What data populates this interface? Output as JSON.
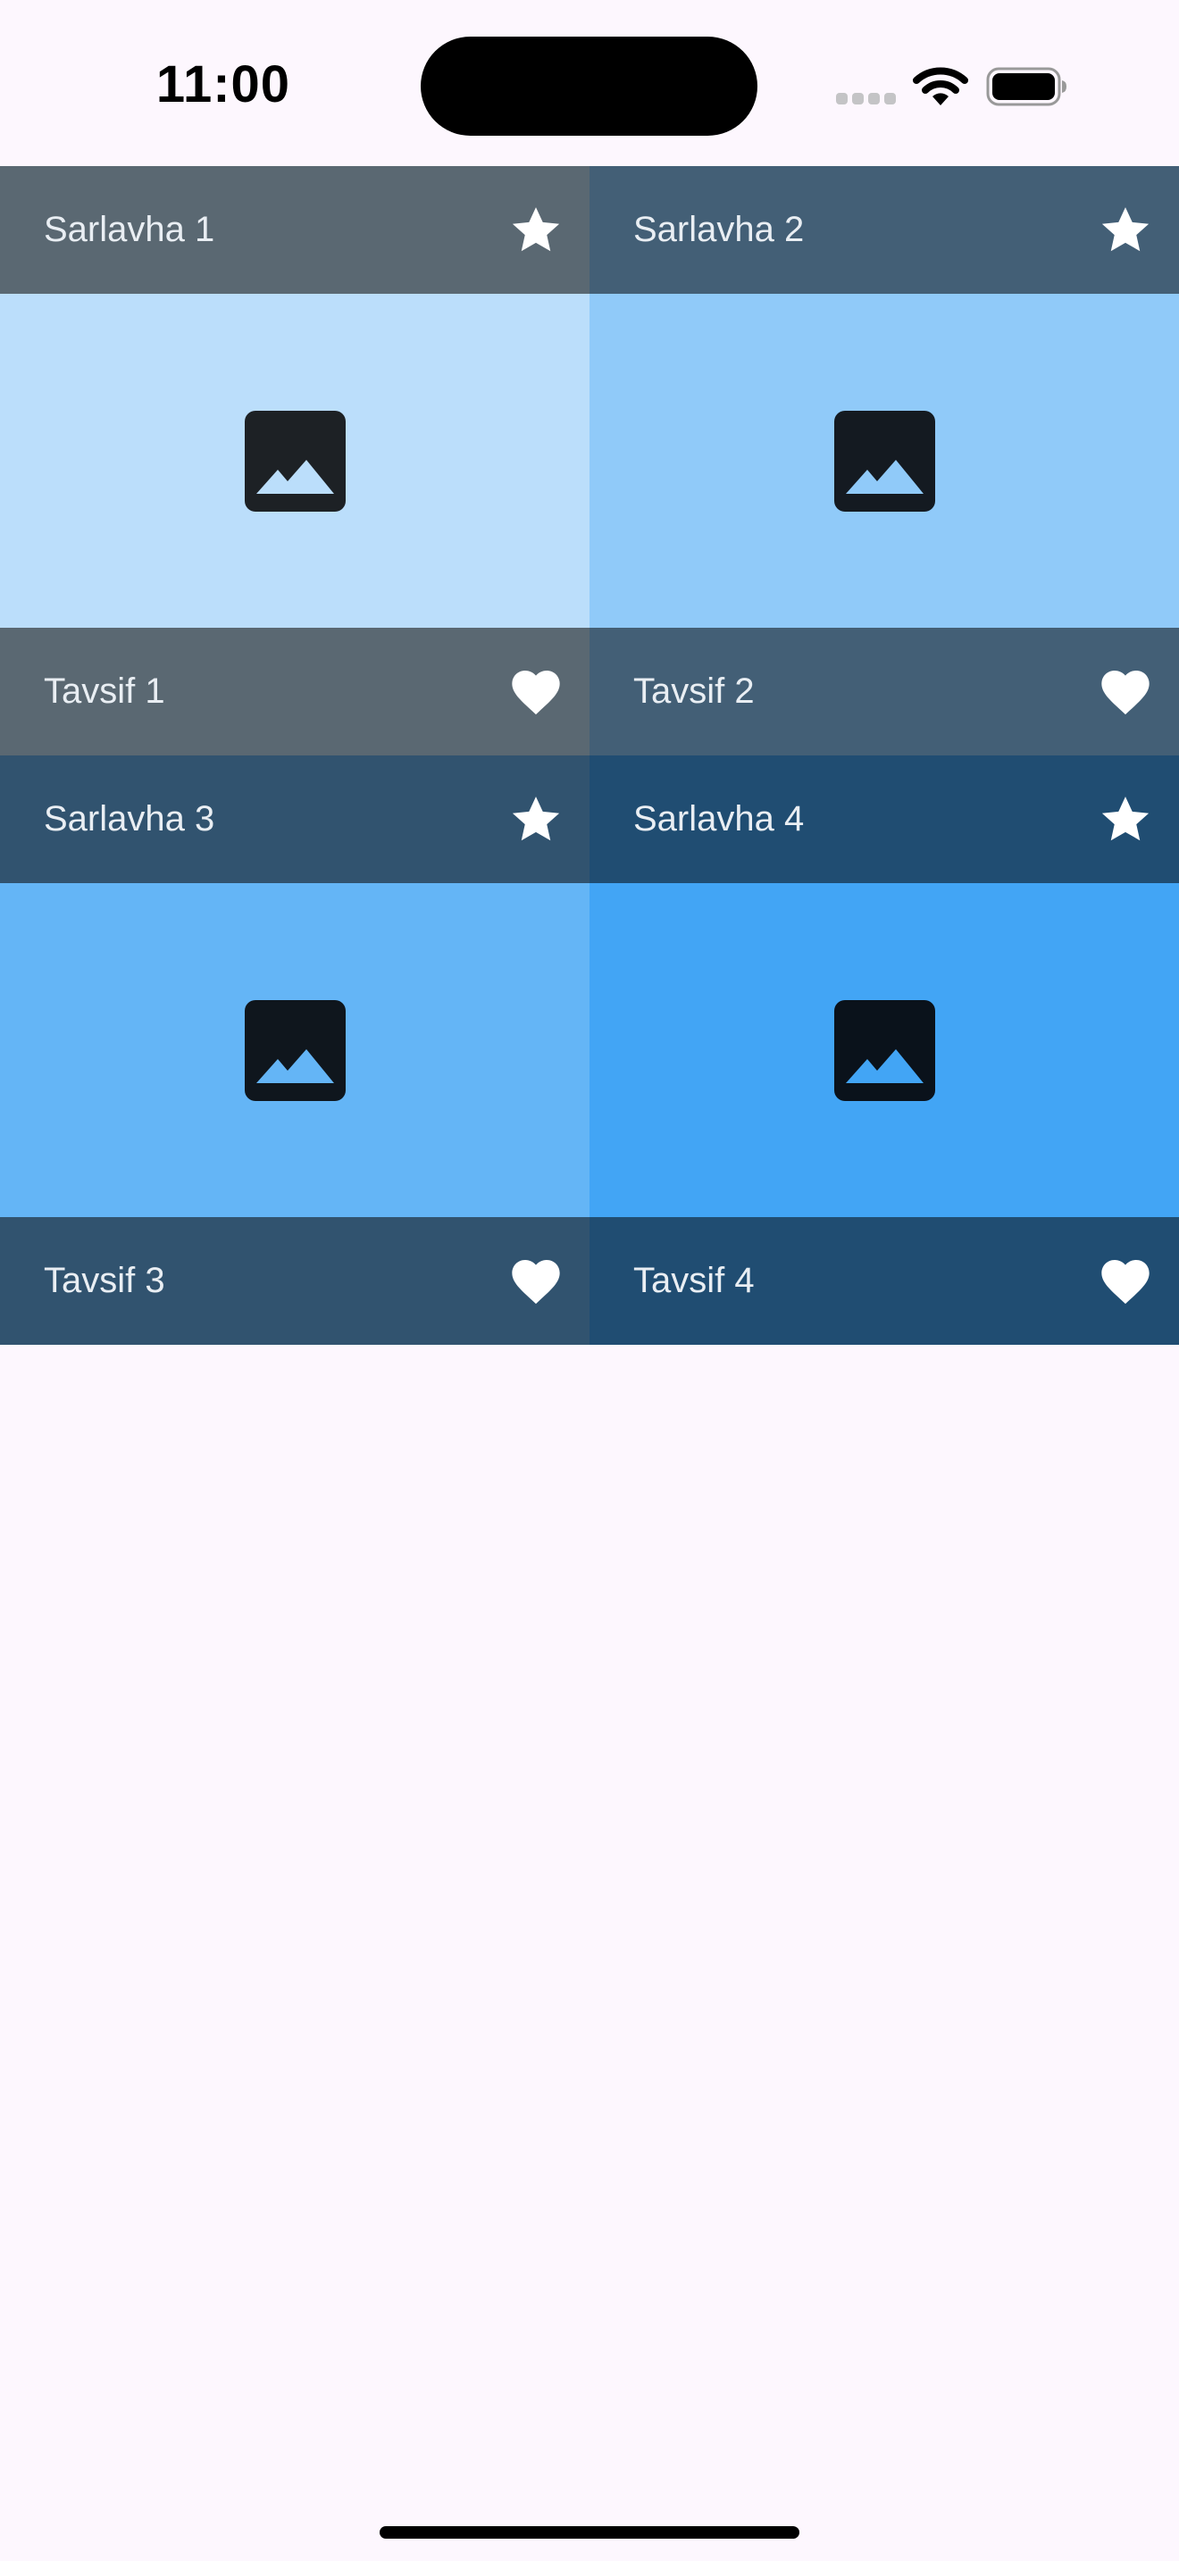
{
  "status_bar": {
    "time": "11:00",
    "icons": [
      "cellular-signal-icon",
      "wifi-icon",
      "battery-icon"
    ]
  },
  "grid": {
    "tiles": [
      {
        "title": "Sarlavha 1",
        "subtitle": "Tavsif 1",
        "bar_color": "#5a6872",
        "image_color": "#bbdefb",
        "icon_fill": "#1d2125",
        "leading_icon": "star-icon",
        "trailing_icon": "heart-icon",
        "image_icon": "photo-icon"
      },
      {
        "title": "Sarlavha 2",
        "subtitle": "Tavsif 2",
        "bar_color": "#435f76",
        "image_color": "#90caf9",
        "icon_fill": "#141a21",
        "leading_icon": "star-icon",
        "trailing_icon": "heart-icon",
        "image_icon": "photo-icon"
      },
      {
        "title": "Sarlavha 3",
        "subtitle": "Tavsif 3",
        "bar_color": "#31536f",
        "image_color": "#64b5f6",
        "icon_fill": "#0f161d",
        "leading_icon": "star-icon",
        "trailing_icon": "heart-icon",
        "image_icon": "photo-icon"
      },
      {
        "title": "Sarlavha 4",
        "subtitle": "Tavsif 4",
        "bar_color": "#204d72",
        "image_color": "#42a5f5",
        "icon_fill": "#0a121b",
        "leading_icon": "star-icon",
        "trailing_icon": "heart-icon",
        "image_icon": "photo-icon"
      }
    ]
  },
  "colors": {
    "background": "#fdf7fe",
    "tile_text": "#e9eef3",
    "tile_icon": "#ffffff"
  }
}
